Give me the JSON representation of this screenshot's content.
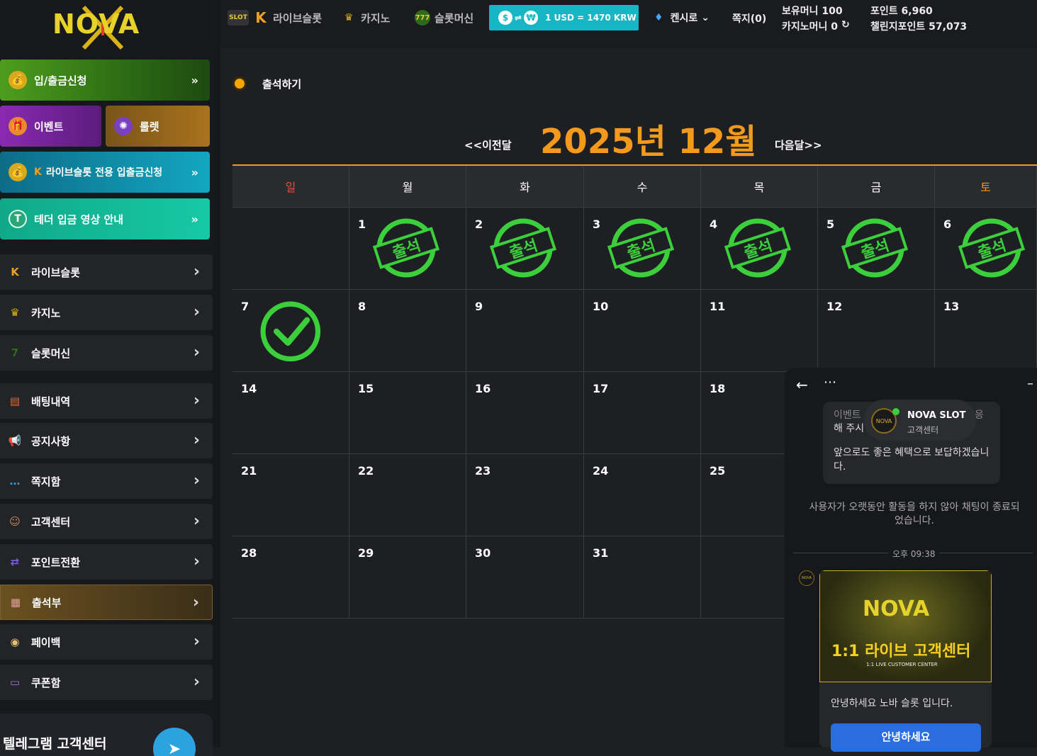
{
  "logo": {
    "text": "NOVA"
  },
  "sidebar": {
    "deposit": "입/출금신청",
    "event": "이벤트",
    "roulette": "룰렛",
    "live_slot_deposit": "라이브슬롯 전용 입출금신청",
    "tether": "테더 입금 영상 안내",
    "menu": [
      {
        "label": "라이브슬롯",
        "icon": "live-slot-icon"
      },
      {
        "label": "카지노",
        "icon": "casino-icon"
      },
      {
        "label": "슬롯머신",
        "icon": "slot-machine-icon"
      },
      {
        "label": "배팅내역",
        "icon": "clipboard-icon"
      },
      {
        "label": "공지사항",
        "icon": "megaphone-icon"
      },
      {
        "label": "쪽지함",
        "icon": "message-icon"
      },
      {
        "label": "고객센터",
        "icon": "support-agent-icon"
      },
      {
        "label": "포인트전환",
        "icon": "exchange-icon"
      },
      {
        "label": "출석부",
        "icon": "calendar-icon"
      },
      {
        "label": "페이백",
        "icon": "coin-icon"
      },
      {
        "label": "쿠폰함",
        "icon": "coupon-icon"
      }
    ],
    "telegram": "텔레그램 고객센터"
  },
  "topbar": {
    "live_slot": "라이브슬롯",
    "casino": "카지노",
    "slot_machine": "슬롯머신",
    "rate": "1 USD = 1470 KRW",
    "cashier": "켄시로",
    "messages": "쪽지(0)",
    "balance": "보유머니 100",
    "casino_money": "카지노머니 0",
    "points": "포인트 6,960",
    "challenge_points": "챌린지포인트 57,073"
  },
  "attendance": {
    "title": "출석하기",
    "month": "2025년 12월",
    "prev": "<<이전달",
    "next": "다음달>>",
    "weekdays": [
      "일",
      "월",
      "화",
      "수",
      "목",
      "금",
      "토"
    ],
    "stamp_text": "출석",
    "weeks": [
      [
        "",
        "1",
        "2",
        "3",
        "4",
        "5",
        "6"
      ],
      [
        "7",
        "8",
        "9",
        "10",
        "11",
        "12",
        "13"
      ],
      [
        "14",
        "15",
        "16",
        "17",
        "18",
        "",
        ""
      ],
      [
        "21",
        "22",
        "23",
        "24",
        "25",
        "",
        ""
      ],
      [
        "28",
        "29",
        "30",
        "31",
        "",
        "",
        ""
      ]
    ],
    "stamped_days": [
      "1",
      "2",
      "3",
      "4",
      "5",
      "6"
    ],
    "checked_days": [
      "7"
    ],
    "colors": {
      "accent": "#f39a1c",
      "sunday": "#e74c3c",
      "saturday": "#f39a1c",
      "stamp": "#3ccf3c"
    }
  },
  "chat": {
    "partial_text_1": "이벤트",
    "partial_text_2": "해 주시",
    "partial_text_3": "응",
    "agent_name": "NOVA SLOT",
    "agent_role": "고객센터",
    "message_1": "앞으로도 좋은 혜택으로 보답하겠습니다.",
    "system_msg": "사용자가 오랫동안 활동을 하지 않아 채팅이 종료되었습니다.",
    "time": "오후 09:38",
    "banner_logo": "NOVA",
    "banner_title": "1:1 라이브 고객센터",
    "banner_sub": "1:1 LIVE CUSTOMER CENTER",
    "greeting": "안녕하세요 노바 슬롯 입니다.",
    "reply_button": "안녕하세요"
  }
}
